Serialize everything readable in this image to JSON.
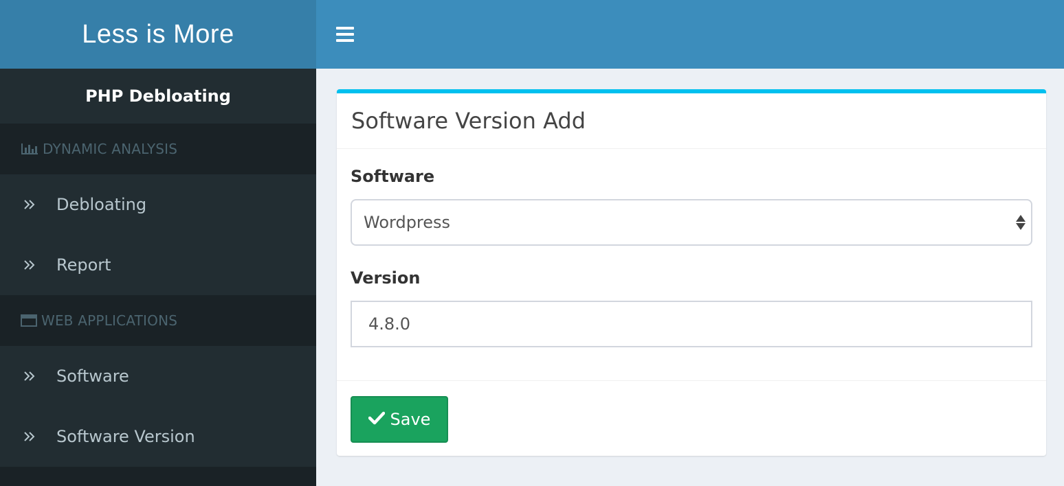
{
  "brand": {
    "logo_text": "Less is More"
  },
  "sidebar": {
    "user_panel_title": "PHP Debloating",
    "sections": [
      {
        "header": "DYNAMIC ANALYSIS",
        "icon": "bar-chart-icon",
        "items": [
          {
            "label": "Debloating",
            "icon": "double-chevron-right-icon"
          },
          {
            "label": "Report",
            "icon": "double-chevron-right-icon"
          }
        ]
      },
      {
        "header": "WEB APPLICATIONS",
        "icon": "window-icon",
        "items": [
          {
            "label": "Software",
            "icon": "double-chevron-right-icon"
          },
          {
            "label": "Software Version",
            "icon": "double-chevron-right-icon"
          }
        ]
      }
    ]
  },
  "header": {
    "menu_icon": "hamburger-icon"
  },
  "form": {
    "title": "Software Version Add",
    "software_label": "Software",
    "software_value": "Wordpress",
    "version_label": "Version",
    "version_value": "4.8.0",
    "save_label": "Save",
    "save_icon": "check-icon"
  },
  "colors": {
    "header_bg": "#3c8dbc",
    "logo_bg": "#367fa9",
    "sidebar_bg": "#222d32",
    "sidebar_section_bg": "#1a2226",
    "box_top_border": "#00c0ef",
    "save_button": "#1aa35e"
  }
}
